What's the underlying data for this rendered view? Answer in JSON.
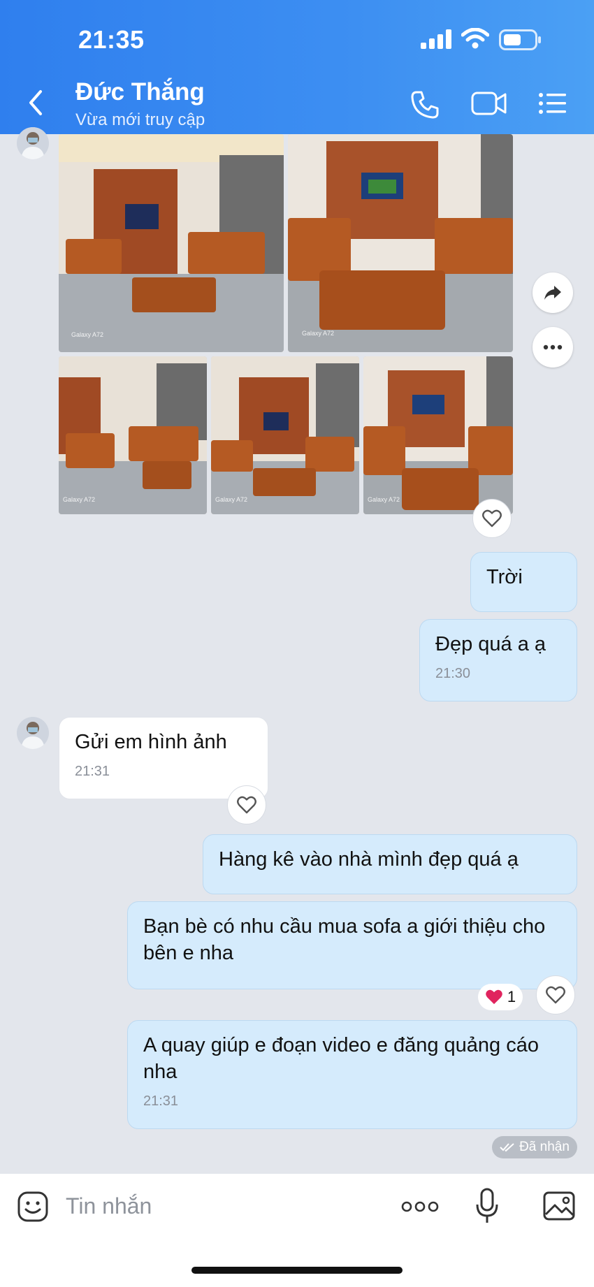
{
  "status_bar": {
    "time": "21:35",
    "icons": [
      "signal-icon",
      "wifi-icon",
      "battery-icon"
    ]
  },
  "header": {
    "title": "Đức Thắng",
    "subtitle": "Vừa mới truy cập",
    "icons": [
      "back-icon",
      "phone-icon",
      "video-call-icon",
      "menu-list-icon"
    ]
  },
  "photo_album": {
    "count": 5,
    "watermark": "Galaxy A72"
  },
  "messages": [
    {
      "dir": "out",
      "text": "Trời"
    },
    {
      "dir": "out",
      "text": "Đẹp quá a ạ",
      "time": "21:30"
    },
    {
      "dir": "in",
      "text": "Gửi em hình ảnh",
      "time": "21:31"
    },
    {
      "dir": "out",
      "text": "Hàng kê vào nhà mình đẹp quá ạ"
    },
    {
      "dir": "out",
      "text": "Bạn bè có nhu cầu mua sofa a giới thiệu cho bên e nha",
      "reaction": {
        "emoji": "❤️",
        "count": "1"
      }
    },
    {
      "dir": "out",
      "text": "A quay giúp e đoạn video e đăng quảng cáo nha",
      "time": "21:31"
    }
  ],
  "delivery_status": "Đã nhận",
  "composer": {
    "placeholder": "Tin nhắn",
    "icons": [
      "sticker-icon",
      "more-icon",
      "microphone-icon",
      "image-icon"
    ]
  },
  "colors": {
    "header_blue": "#3d8ff2",
    "outgoing_bubble": "#d5ebfc",
    "incoming_bubble": "#ffffff",
    "chat_background": "#e3e6ec",
    "reaction_heart": "#e0245e"
  }
}
